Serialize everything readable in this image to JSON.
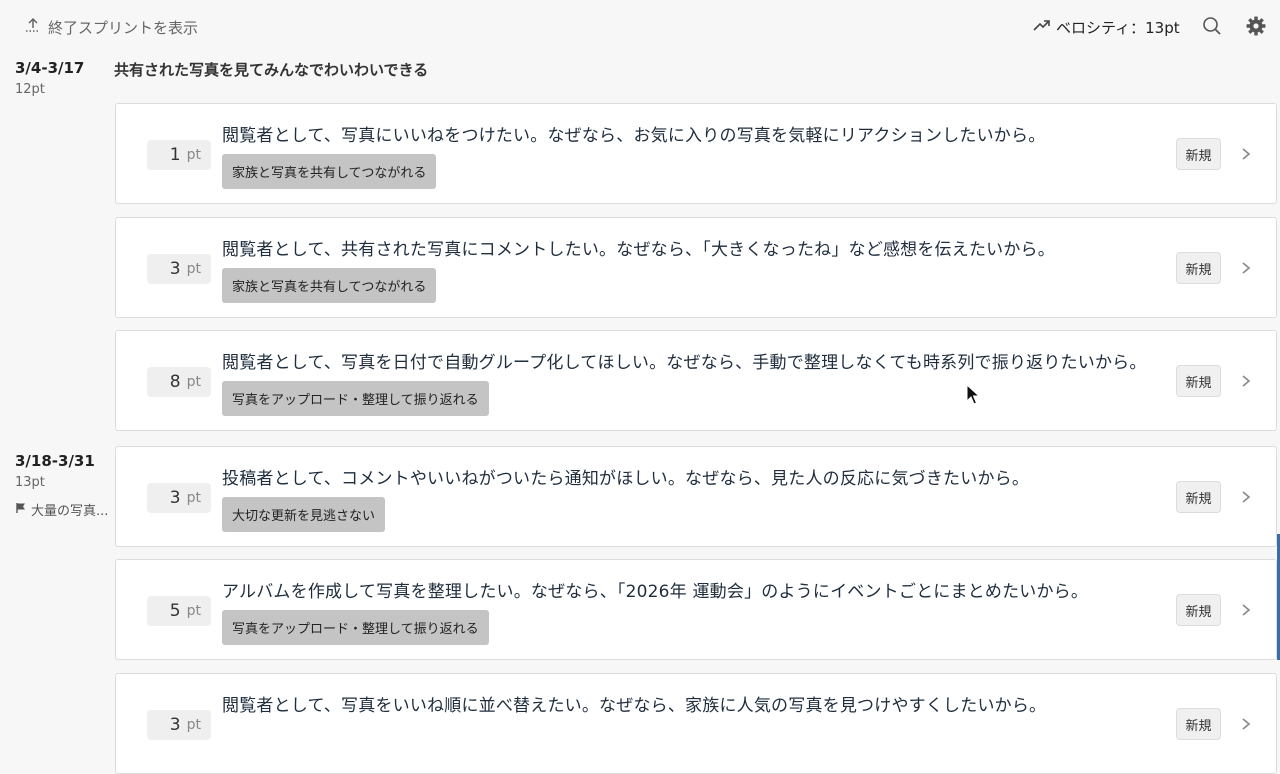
{
  "header": {
    "show_ended_label": "終了スプリントを表示",
    "velocity_label": "ベロシティ：13pt"
  },
  "sprints": [
    {
      "date_range": "3/4-3/17",
      "points": "12pt",
      "goal": "共有された写真を見てみんなでわいわいできる",
      "flag": ""
    },
    {
      "date_range": "3/18-3/31",
      "points": "13pt",
      "goal": "",
      "flag": "大量の写真..."
    }
  ],
  "stories": [
    {
      "points": "1",
      "unit": "pt",
      "text": "閲覧者として、写真にいいねをつけたい。なぜなら、お気に入りの写真を気軽にリアクションしたいから。",
      "epic": "家族と写真を共有してつながれる",
      "status": "新規"
    },
    {
      "points": "3",
      "unit": "pt",
      "text": "閲覧者として、共有された写真にコメントしたい。なぜなら、「大きくなったね」など感想を伝えたいから。",
      "epic": "家族と写真を共有してつながれる",
      "status": "新規"
    },
    {
      "points": "8",
      "unit": "pt",
      "text": "閲覧者として、写真を日付で自動グループ化してほしい。なぜなら、手動で整理しなくても時系列で振り返りたいから。",
      "epic": "写真をアップロード・整理して振り返れる",
      "status": "新規"
    },
    {
      "points": "3",
      "unit": "pt",
      "text": "投稿者として、コメントやいいねがついたら通知がほしい。なぜなら、見た人の反応に気づきたいから。",
      "epic": "大切な更新を見逃さない",
      "status": "新規"
    },
    {
      "points": "5",
      "unit": "pt",
      "text": "アルバムを作成して写真を整理したい。なぜなら、「2026年 運動会」のようにイベントごとにまとめたいから。",
      "epic": "写真をアップロード・整理して振り返れる",
      "status": "新規"
    },
    {
      "points": "3",
      "unit": "pt",
      "text": "閲覧者として、写真をいいね順に並べ替えたい。なぜなら、家族に人気の写真を見つけやすくしたいから。",
      "epic": "",
      "status": "新規"
    }
  ],
  "icons": {
    "show_ended": "upload-arrow-icon",
    "velocity": "trend-up-icon",
    "search": "search-icon",
    "settings": "gear-icon",
    "flag": "flag-icon",
    "row_open": "chevron-right-icon"
  }
}
